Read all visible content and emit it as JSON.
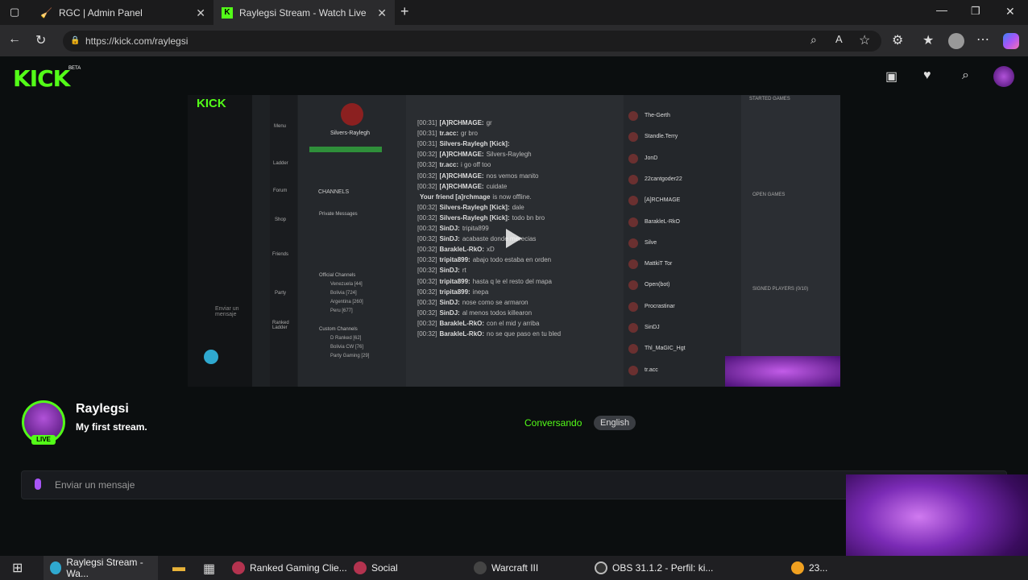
{
  "browser": {
    "tabs": [
      {
        "title": "RGC | Admin Panel",
        "active": false
      },
      {
        "title": "Raylegsi Stream - Watch Live on K",
        "active": true
      }
    ],
    "url": "https://kick.com/raylegsi"
  },
  "site": {
    "logo": "KICK",
    "beta": "BETA"
  },
  "video": {
    "overlay": {
      "logo": "KICK",
      "nav": [
        "Menu",
        "Ladder",
        "Forum",
        "Shop",
        "Friends",
        "Party",
        "Ranked Ladder"
      ],
      "channels": {
        "user": "Silvers-Raylegh",
        "header": "CHANNELS",
        "private_header": "Private Messages",
        "official_header": "Official Channels",
        "official": [
          "Venezuela [44]",
          "Bolivia [724]",
          "Argentina [260]",
          "Peru [677]"
        ],
        "custom_header": "Custom Channels",
        "custom": [
          "D Ranked [62]",
          "Bolivia CW [76]",
          "Party Gaming [29]"
        ]
      },
      "chat": [
        {
          "t": "[00:31]",
          "u": "[A]RCHMAGE:",
          "m": "gr"
        },
        {
          "t": "[00:31]",
          "u": "tr.acc:",
          "m": "gr bro"
        },
        {
          "t": "[00:31]",
          "u": "Silvers-Raylegh [Kick]:",
          "m": ""
        },
        {
          "t": "[00:32]",
          "u": "[A]RCHMAGE:",
          "m": "Silvers-Raylegh"
        },
        {
          "t": "[00:32]",
          "u": "tr.acc:",
          "m": "i go off too"
        },
        {
          "t": "[00:32]",
          "u": "[A]RCHMAGE:",
          "m": "nos vemos manito"
        },
        {
          "t": "[00:32]",
          "u": "[A]RCHMAGE:",
          "m": "cuidate"
        },
        {
          "t": "",
          "u": "Your friend [a]rchmage",
          "m": "is now offline."
        },
        {
          "t": "[00:32]",
          "u": "Silvers-Raylegh [Kick]:",
          "m": "dale"
        },
        {
          "t": "[00:32]",
          "u": "Silvers-Raylegh [Kick]:",
          "m": "todo bn bro"
        },
        {
          "t": "[00:32]",
          "u": "SinDJ:",
          "m": "tripita899"
        },
        {
          "t": "[00:32]",
          "u": "SinDJ:",
          "m": "acabaste donde merecias"
        },
        {
          "t": "[00:32]",
          "u": "BarakleL-RkO:",
          "m": "xD"
        },
        {
          "t": "[00:32]",
          "u": "tripita899:",
          "m": "abajo todo estaba en orden"
        },
        {
          "t": "[00:32]",
          "u": "SinDJ:",
          "m": "rt"
        },
        {
          "t": "[00:32]",
          "u": "tripita899:",
          "m": "hasta q le el resto del mapa"
        },
        {
          "t": "[00:32]",
          "u": "tripita899:",
          "m": "inepa"
        },
        {
          "t": "[00:32]",
          "u": "SinDJ:",
          "m": "nose como se armaron"
        },
        {
          "t": "[00:32]",
          "u": "SinDJ:",
          "m": "al menos todos killearon"
        },
        {
          "t": "[00:32]",
          "u": "BarakleL-RkO:",
          "m": "con el mid y arriba"
        },
        {
          "t": "[00:32]",
          "u": "BarakleL-RkO:",
          "m": "no se que paso en tu bled"
        }
      ],
      "users": [
        "The-Gerth",
        "Standle.Terry",
        "JonD",
        "22cantgoder22",
        "[A]RCHMAGE",
        "BarakleL-RkO",
        "Silve",
        "MattkiT Tor",
        "Open(bot)",
        "Procrastinar",
        "SinDJ",
        "Thl_MaGIC_Hgt",
        "tr.acc"
      ],
      "games_header": "STARTED GAMES",
      "open_games_header": "OPEN GAMES",
      "signed_header": "SIGNED PLAYERS (0/10)",
      "chat_placeholder": "Enviar un mensaje"
    }
  },
  "streamer": {
    "name": "Raylegsi",
    "title": "My first stream.",
    "live_badge": "LIVE",
    "category": "Conversando",
    "language": "English"
  },
  "chat": {
    "placeholder": "Enviar un mensaje"
  },
  "taskbar": {
    "items": [
      {
        "label": "Raylegsi Stream - Wa...",
        "icon": "edge-icon"
      },
      {
        "label": "Ranked Gaming Clie...",
        "icon": "rgc-icon"
      },
      {
        "label": "Social",
        "icon": "social-icon"
      },
      {
        "label": "Warcraft III",
        "icon": "warcraft-icon"
      },
      {
        "label": "OBS 31.1.2 - Perfil: ki...",
        "icon": "obs-icon"
      }
    ],
    "weather": "23..."
  },
  "colors": {
    "accent": "#53fc18",
    "bg": "#0b0e0f"
  }
}
